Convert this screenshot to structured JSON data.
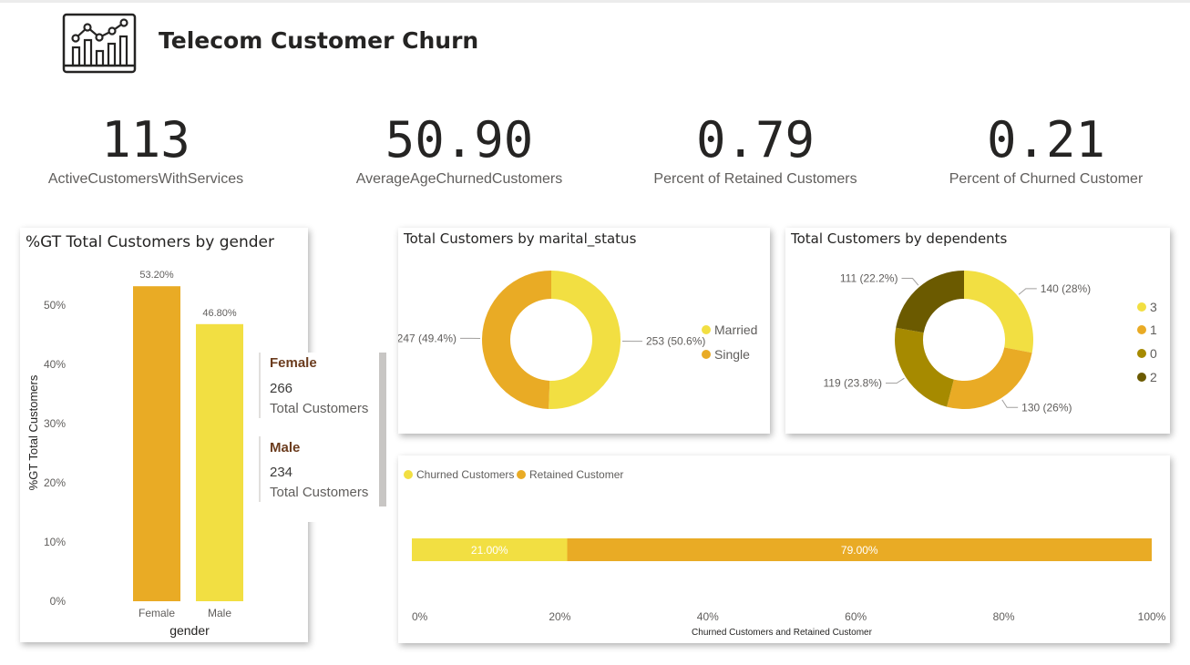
{
  "header": {
    "title": "Telecom Customer Churn",
    "logo_icon": "line-chart-icon"
  },
  "kpis": [
    {
      "value": "113",
      "label": "ActiveCustomersWithServices"
    },
    {
      "value": "50.90",
      "label": "AverageAgeChurnedCustomers"
    },
    {
      "value": "0.79",
      "label": "Percent of Retained Customers"
    },
    {
      "value": "0.21",
      "label": "Percent of Churned Customer"
    }
  ],
  "tooltip": {
    "items": [
      {
        "category": "Female",
        "value": "266",
        "label": "Total Customers"
      },
      {
        "category": "Male",
        "value": "234",
        "label": "Total Customers"
      }
    ]
  },
  "colors": {
    "yellow": "#f2df42",
    "orange": "#e9ab25",
    "olive": "#a68a00",
    "dark_olive": "#6b5a00"
  },
  "chart_data": [
    {
      "type": "bar",
      "title": "%GT Total Customers by gender",
      "xlabel": "gender",
      "ylabel": "%GT Total Customers",
      "categories": [
        "Female",
        "Male"
      ],
      "values": [
        53.2,
        46.8
      ],
      "data_labels": [
        "53.20%",
        "46.80%"
      ],
      "colors": [
        "#e9ab25",
        "#f2df42"
      ],
      "ylim": [
        0,
        60
      ],
      "yticks": [
        0,
        10,
        20,
        30,
        40,
        50
      ],
      "ytick_labels": [
        "0%",
        "10%",
        "20%",
        "30%",
        "40%",
        "50%"
      ]
    },
    {
      "type": "pie",
      "title": "Total Customers by marital_status",
      "labels": [
        "Married",
        "Single"
      ],
      "values": [
        253,
        247
      ],
      "data_labels": [
        "253 (50.6%)",
        "247 (49.4%)"
      ],
      "colors": [
        "#f2df42",
        "#e9ab25"
      ],
      "legend": "right"
    },
    {
      "type": "pie",
      "title": "Total Customers by dependents",
      "labels": [
        "3",
        "1",
        "0",
        "2"
      ],
      "values": [
        140,
        130,
        119,
        111
      ],
      "data_labels": [
        "140 (28%)",
        "130 (26%)",
        "119 (23.8%)",
        "111 (22.2%)"
      ],
      "colors": [
        "#f2df42",
        "#e9ab25",
        "#a68a00",
        "#6b5a00"
      ],
      "legend": "right"
    },
    {
      "type": "bar",
      "orientation": "horizontal-stacked-100",
      "xlabel": "Churned Customers and Retained Customer",
      "series": [
        {
          "name": "Churned Customers",
          "value": 21.0,
          "data_label": "21.00%",
          "color": "#f2df42"
        },
        {
          "name": "Retained Customer",
          "value": 79.0,
          "data_label": "79.00%",
          "color": "#e9ab25"
        }
      ],
      "xlim": [
        0,
        100
      ],
      "xticks": [
        0,
        20,
        40,
        60,
        80,
        100
      ],
      "xtick_labels": [
        "0%",
        "20%",
        "40%",
        "60%",
        "80%",
        "100%"
      ],
      "legend": "top-left"
    }
  ]
}
